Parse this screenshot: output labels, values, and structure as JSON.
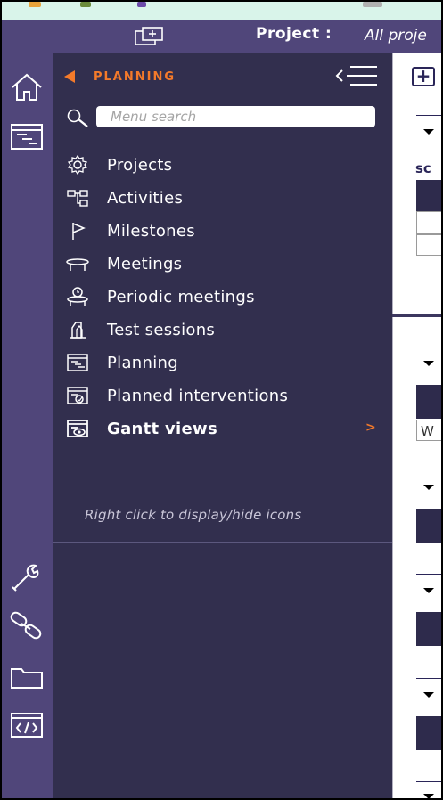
{
  "header": {
    "project_label": "Project :",
    "project_value": "All proje"
  },
  "menu": {
    "title": "PLANNING",
    "search_placeholder": "Menu search",
    "items": [
      {
        "label": "Projects",
        "icon": "gear-icon"
      },
      {
        "label": "Activities",
        "icon": "activities-tree-icon"
      },
      {
        "label": "Milestones",
        "icon": "flag-icon"
      },
      {
        "label": "Meetings",
        "icon": "meeting-table-icon"
      },
      {
        "label": "Periodic meetings",
        "icon": "periodic-meeting-icon"
      },
      {
        "label": "Test sessions",
        "icon": "test-flask-icon"
      },
      {
        "label": "Planning",
        "icon": "planning-icon"
      },
      {
        "label": "Planned interventions",
        "icon": "planned-intervention-icon"
      },
      {
        "label": "Gantt views",
        "icon": "gantt-view-icon",
        "bold": true,
        "submenu_arrow": ">"
      }
    ],
    "hint": "Right click to display/hide icons"
  },
  "rail": {
    "items": [
      "home-icon",
      "planning-icon",
      "wrench-icon",
      "link-icon",
      "folder-icon",
      "code-icon"
    ]
  },
  "content": {
    "add_button": "+",
    "sc_label": "sc",
    "w_label": "W"
  },
  "colors": {
    "rail_bg": "#50467a",
    "menu_bg": "#322f4e",
    "accent": "#f47a2a",
    "browser_strip": "#d9f4ea"
  }
}
